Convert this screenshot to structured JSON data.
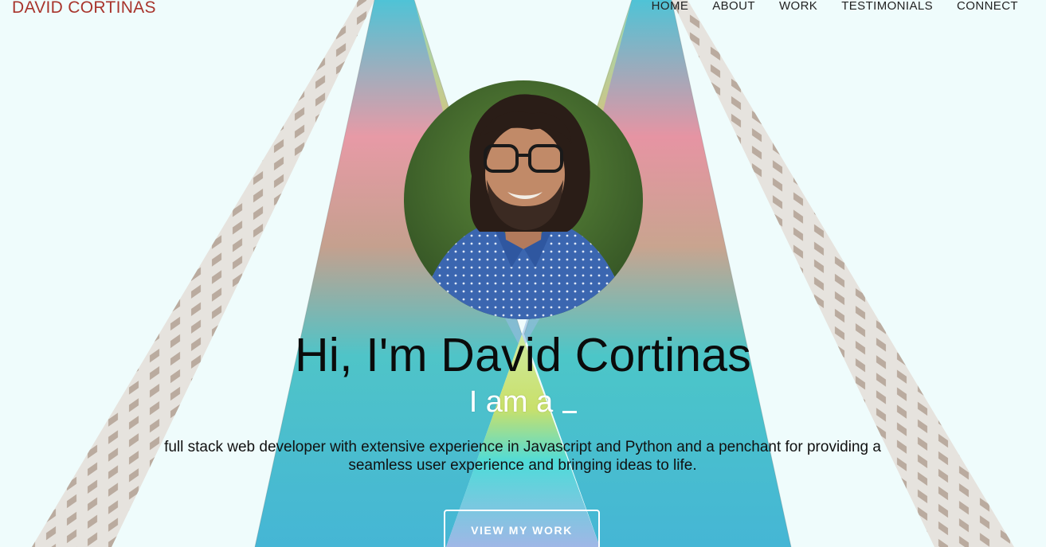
{
  "header": {
    "brand": "DAVID CORTINAS",
    "nav": [
      {
        "label": "HOME"
      },
      {
        "label": "ABOUT"
      },
      {
        "label": "WORK"
      },
      {
        "label": "TESTIMONIALS"
      },
      {
        "label": "CONNECT"
      }
    ]
  },
  "hero": {
    "title": "Hi, I'm David Cortinas",
    "subtitle": "I am a",
    "description": "full stack web developer with extensive experience in Javascript and Python and a penchant for providing a seamless user experience and bringing ideas to life.",
    "cta_label": "VIEW MY WORK"
  },
  "colors": {
    "brand": "#a8342c",
    "background": "#effcfc",
    "accent_teal": "#3fd6d8"
  }
}
